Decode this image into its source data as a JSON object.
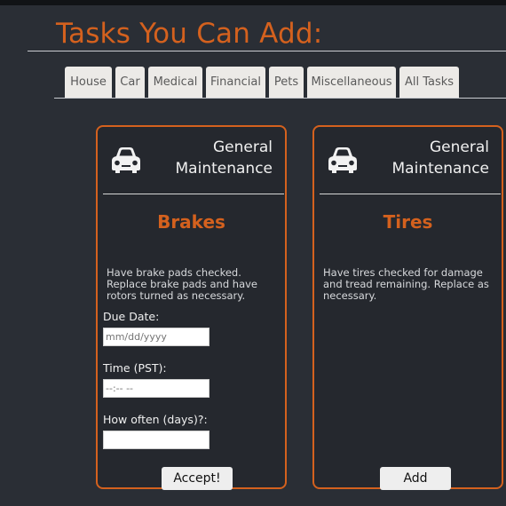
{
  "page": {
    "title": "Tasks You Can Add:"
  },
  "tabs": [
    {
      "label": "House"
    },
    {
      "label": "Car"
    },
    {
      "label": "Medical"
    },
    {
      "label": "Financial"
    },
    {
      "label": "Pets"
    },
    {
      "label": "Miscellaneous"
    },
    {
      "label": "All Tasks"
    }
  ],
  "cards": [
    {
      "icon": "car-icon",
      "category_line1": "General",
      "category_line2": "Maintenance",
      "title": "Brakes",
      "description": "Have brake pads checked. Replace brake pads and have rotors turned as necessary.",
      "due_date_label": "Due Date:",
      "due_date_placeholder": "mm/dd/yyyy",
      "time_label": "Time (PST):",
      "time_placeholder": "--:-- --",
      "frequency_label": "How often (days)?:",
      "frequency_value": "",
      "button_label": "Accept!"
    },
    {
      "icon": "car-icon",
      "category_line1": "General",
      "category_line2": "Maintenance",
      "title": "Tires",
      "description": "Have tires checked for damage and tread remaining. Replace as necessary.",
      "button_label": "Add"
    }
  ],
  "colors": {
    "accent": "#d4611e",
    "background": "#2a2e35",
    "card_bg": "#25282e"
  }
}
